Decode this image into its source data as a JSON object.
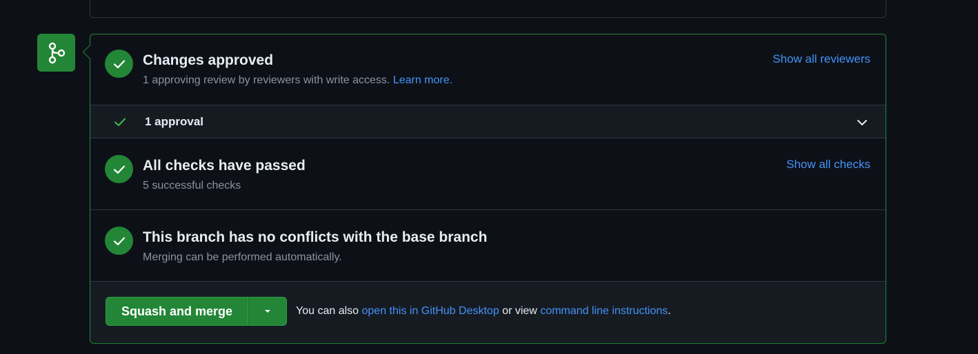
{
  "previous_card": {
    "cut_text": "· · · ·  · · ·"
  },
  "approved": {
    "title": "Changes approved",
    "subtitle_prefix": "1 approving review by reviewers with write access.",
    "learn_more": "Learn more.",
    "show_reviewers": "Show all reviewers"
  },
  "approval_row": {
    "label": "1 approval"
  },
  "checks": {
    "title": "All checks have passed",
    "subtitle": "5 successful checks",
    "show_checks": "Show all checks"
  },
  "conflicts": {
    "title": "This branch has no conflicts with the base branch",
    "subtitle": "Merging can be performed automatically."
  },
  "merge": {
    "button_label": "Squash and merge",
    "note_prefix": "You can also",
    "desktop_link": "open this in GitHub Desktop",
    "note_middle": "or view",
    "cli_link": "command line instructions",
    "note_suffix": "."
  },
  "icons": {
    "merge_badge": "git-merge-icon",
    "status": "check-icon",
    "chevron": "chevron-down-icon",
    "caret": "triangle-down-icon"
  },
  "colors": {
    "success": "#238636",
    "link": "#4493f8",
    "muted": "#8b949e",
    "background": "#0d1117",
    "subtle_bg": "#161b22",
    "border": "#30363d"
  }
}
